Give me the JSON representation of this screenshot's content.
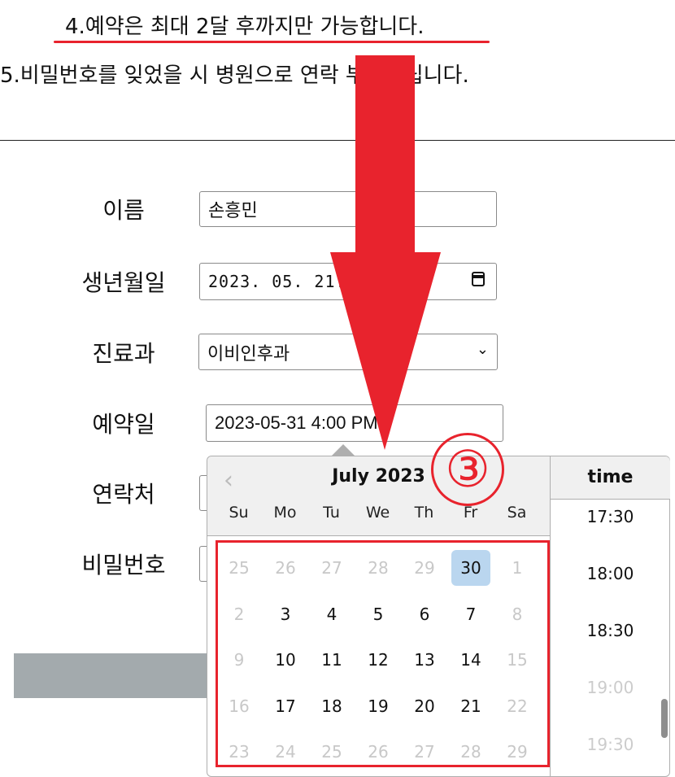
{
  "notices": {
    "line4": "4.예약은 최대 2달 후까지만 가능합니다.",
    "line5": "5.비밀번호를 잊었을 시 병원으로 연락 부탁드립니다."
  },
  "form": {
    "name_label": "이름",
    "name_value": "손흥민",
    "birth_label": "생년월일",
    "birth_value": "2023. 05. 21.",
    "dept_label": "진료과",
    "dept_value": "이비인후과",
    "date_label": "예약일",
    "date_value": "2023-05-31 4:00 PM",
    "phone_label": "연락처",
    "password_label": "비밀번호"
  },
  "datepicker": {
    "month_title": "July 2023",
    "weekdays": [
      "Su",
      "Mo",
      "Tu",
      "We",
      "Th",
      "Fr",
      "Sa"
    ],
    "weeks": [
      [
        "25",
        "26",
        "27",
        "28",
        "29",
        "30",
        "1"
      ],
      [
        "2",
        "3",
        "4",
        "5",
        "6",
        "7",
        "8"
      ],
      [
        "9",
        "10",
        "11",
        "12",
        "13",
        "14",
        "15"
      ],
      [
        "16",
        "17",
        "18",
        "19",
        "20",
        "21",
        "22"
      ],
      [
        "23",
        "24",
        "25",
        "26",
        "27",
        "28",
        "29"
      ]
    ],
    "selected_day": "30",
    "time_header": "time",
    "times": [
      "17:30",
      "18:00",
      "18:30",
      "19:00",
      "19:30"
    ],
    "disabled_times": [
      "19:00",
      "19:30"
    ]
  },
  "annotation": {
    "step_number": "③",
    "color": "#e8232d"
  },
  "colors": {
    "selected_day_bg": "#bad6ef",
    "button_gray": "#a3aaad"
  }
}
